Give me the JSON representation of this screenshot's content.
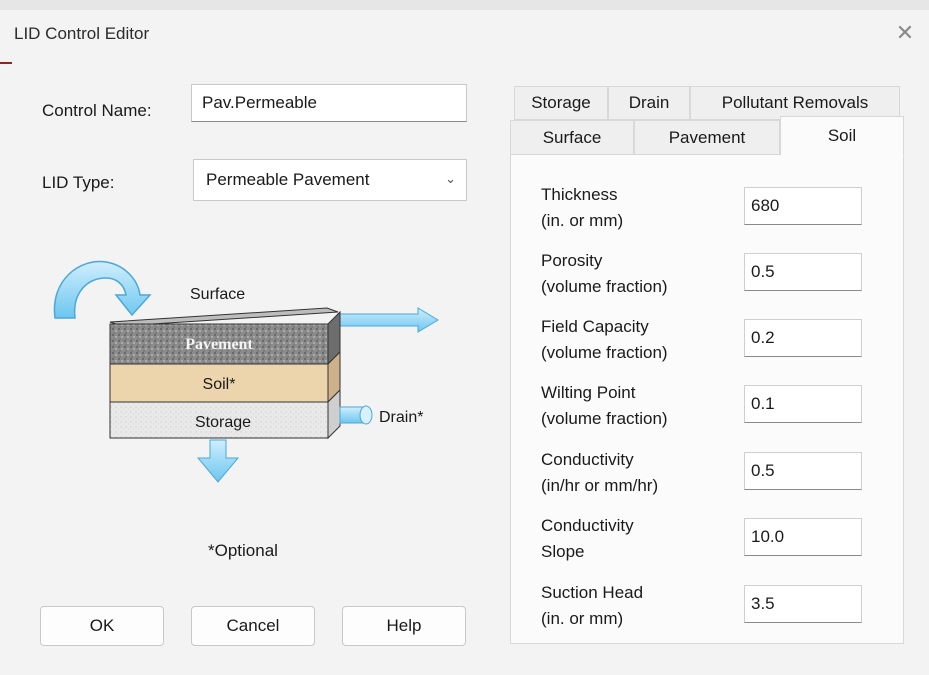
{
  "window": {
    "title": "LID Control Editor",
    "close_symbol": "✕"
  },
  "control_name": {
    "label": "Control Name:",
    "value": "Pav.Permeable"
  },
  "lid_type": {
    "label": "LID Type:",
    "value": "Permeable Pavement"
  },
  "diagram": {
    "surface": "Surface",
    "pavement": "Pavement",
    "soil": "Soil*",
    "storage": "Storage",
    "drain": "Drain*"
  },
  "optional_note": "*Optional",
  "buttons": {
    "ok": "OK",
    "cancel": "Cancel",
    "help": "Help"
  },
  "tabs": {
    "row1": [
      "Storage",
      "Drain",
      "Pollutant Removals"
    ],
    "row2": [
      "Surface",
      "Pavement",
      "Soil"
    ],
    "active": "Soil"
  },
  "fields": [
    {
      "line1": "Thickness",
      "line2": "(in. or mm)",
      "value": "680"
    },
    {
      "line1": "Porosity",
      "line2": "(volume fraction)",
      "value": "0.5"
    },
    {
      "line1": "Field Capacity",
      "line2": "(volume fraction)",
      "value": "0.2"
    },
    {
      "line1": "Wilting Point",
      "line2": "(volume fraction)",
      "value": "0.1"
    },
    {
      "line1": "Conductivity",
      "line2": "(in/hr or mm/hr)",
      "value": "0.5"
    },
    {
      "line1": "Conductivity",
      "line2": "Slope",
      "value": "10.0"
    },
    {
      "line1": "Suction Head",
      "line2": "(in. or mm)",
      "value": "3.5"
    }
  ]
}
